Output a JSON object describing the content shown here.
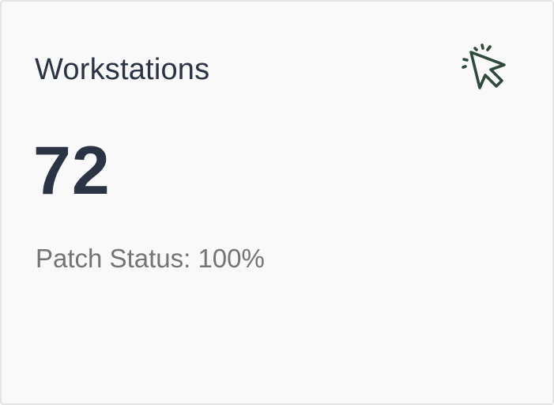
{
  "card": {
    "title": "Workstations",
    "value": "72",
    "status_label": "Patch Status: ",
    "status_value": "100%",
    "icon": "cursor-click-icon",
    "icon_color": "#2f4a3a"
  }
}
